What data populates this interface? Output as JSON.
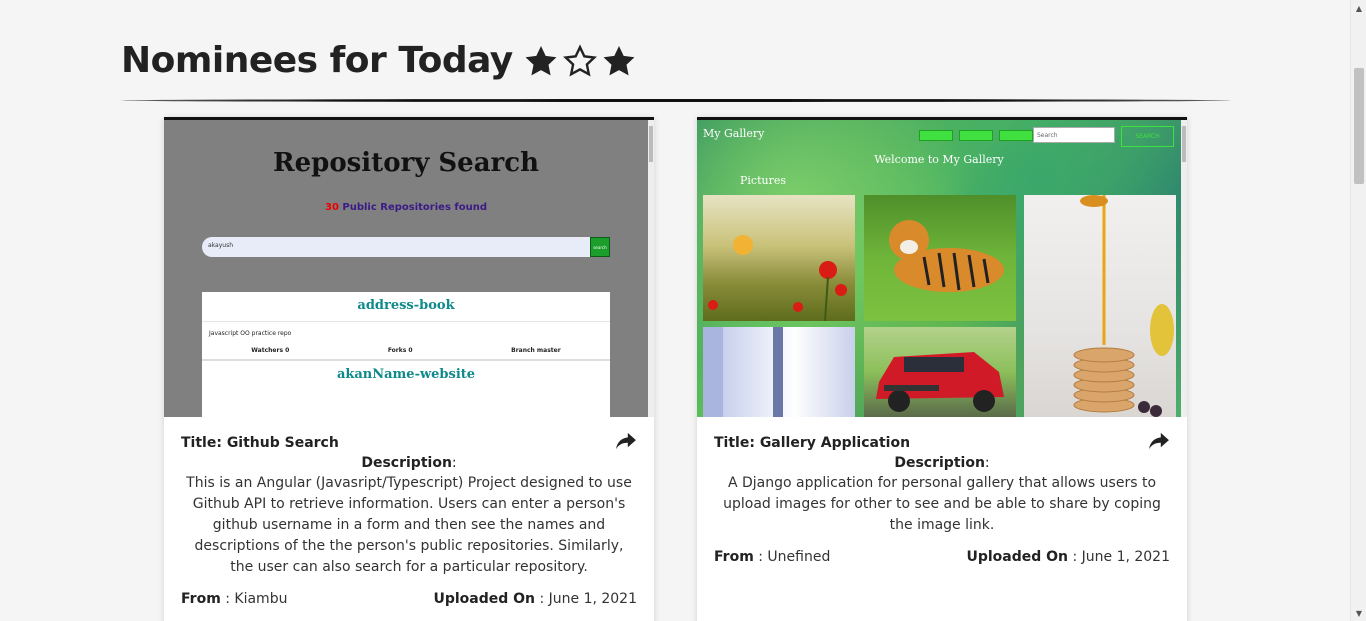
{
  "heading": {
    "title": "Nominees for Today",
    "stars": [
      "filled",
      "outline",
      "filled"
    ]
  },
  "cards": [
    {
      "title_prefix": "Title:",
      "title": "Github Search",
      "description_label": "Description",
      "description": "This is an Angular (Javasript/Typescript) Project designed to use Github API to retrieve information. Users can enter a person's github username in a form and then see the names and descriptions of the the person's public repositories. Similarly, the user can also search for a particular repository.",
      "from_label": "From",
      "from": "Kiambu",
      "uploaded_label": "Uploaded On",
      "uploaded": "June 1, 2021",
      "preview": {
        "heading": "Repository Search",
        "count": "30",
        "count_text": "Public Repositories found",
        "search_value": "akayush",
        "search_button": "search",
        "repos": [
          {
            "name": "address-book",
            "description": "Javascript OO practice repo",
            "watchers": "Watchers 0",
            "forks": "Forks 0",
            "branch": "Branch master"
          },
          {
            "name": "akanName-website"
          }
        ]
      }
    },
    {
      "title_prefix": "Title:",
      "title": "Gallery Application",
      "description_label": "Description",
      "description": "A Django application for personal gallery that allows users to upload images for other to see and be able to share by coping the image link.",
      "from_label": "From",
      "from": "Unefined",
      "uploaded_label": "Uploaded On",
      "uploaded": "June 1, 2021",
      "preview": {
        "brand": "My Gallery",
        "search_placeholder": "Search",
        "search_button": "SEARCH",
        "welcome": "Welcome to My Gallery",
        "section": "Pictures"
      }
    }
  ],
  "icons": {
    "share": "share-icon",
    "star_filled": "star-filled-icon",
    "star_outline": "star-outline-icon"
  }
}
